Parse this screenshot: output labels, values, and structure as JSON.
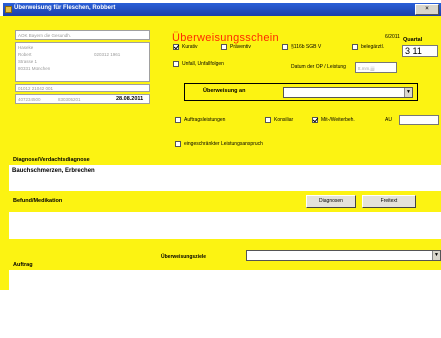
{
  "window": {
    "title": "Überweisung für Fleschen, Robbert"
  },
  "patient": {
    "insurer": "AOK Bayern die Gesundh.",
    "name_lines": [
      "Haseke",
      "Robert",
      "Strasse 1",
      "80331 München"
    ],
    "dob": "020312 1961",
    "kv_line": "01012 21042 001",
    "ids": [
      "407234500",
      "830305201"
    ],
    "date": "28.08.2011"
  },
  "form": {
    "heading": "Überweisungsschein",
    "form_number": "6/2011",
    "quarter_label": "Quartal",
    "quarter_value": "3   11",
    "checks_top": [
      {
        "label": "Kurativ",
        "checked": true
      },
      {
        "label": "Präventiv",
        "checked": false
      },
      {
        "label": "§116b SGB V",
        "checked": false
      },
      {
        "label": "belegärztl.",
        "checked": false
      }
    ],
    "unfall_label": "Unfall, Unfallfolgen",
    "op_date_label": "Datum der OP / Leistung",
    "op_date_placeholder": "tt.mm.jjjj",
    "ueberweisung_label": "Überweisung an",
    "ueberweisung_value": "",
    "checks_mid": [
      {
        "label": "Auftragsleistungen",
        "checked": false
      },
      {
        "label": "Konsiliar",
        "checked": false
      },
      {
        "label": "Mit-/Weiterbeh.",
        "checked": true
      }
    ],
    "aue_label": "AU",
    "aue_value": "",
    "restricted_label": "eingeschränkter Leistungsanspruch",
    "diagnose_label": "Diagnose/Verdachtsdiagnose",
    "diagnose_value": "Bauchschmerzen, Erbrechen",
    "befund_label": "Befund/Medikation",
    "diagnosen_button": "Diagnosen",
    "reset_button": "Freitext",
    "auftrag_label": "Auftrag",
    "ziel_label": "Überweisungsziele",
    "ziel_value": ""
  },
  "colors": {
    "form_bg": "#fcf312",
    "heading": "#ff2a00",
    "titlebar": "#2a5fd8"
  }
}
